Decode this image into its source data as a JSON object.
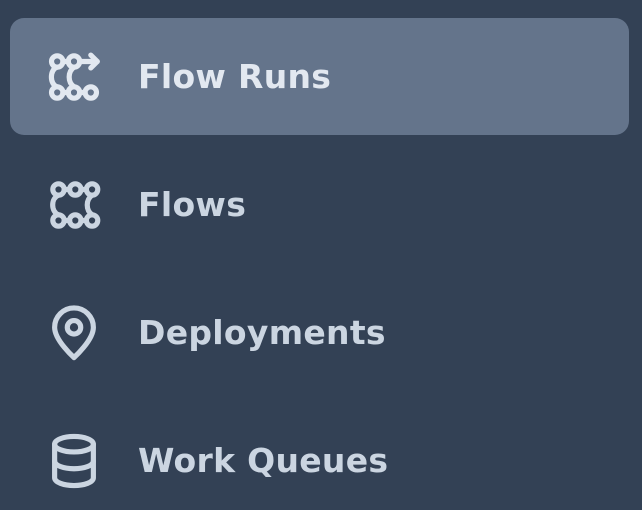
{
  "sidebar": {
    "items": [
      {
        "label": "Flow Runs",
        "icon": "flow-runs-icon",
        "active": true
      },
      {
        "label": "Flows",
        "icon": "flows-icon",
        "active": false
      },
      {
        "label": "Deployments",
        "icon": "map-pin-icon",
        "active": false
      },
      {
        "label": "Work Queues",
        "icon": "database-icon",
        "active": false
      }
    ]
  },
  "colors": {
    "background": "#334155",
    "active_background": "#64748b",
    "text": "#cbd5e1"
  }
}
